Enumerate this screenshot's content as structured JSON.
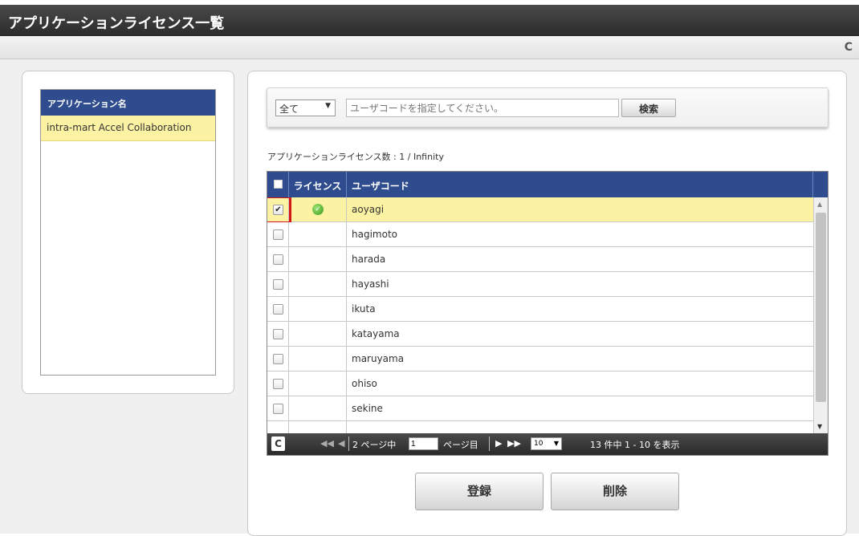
{
  "window": {
    "title": "アプリケーションライセンス一覧"
  },
  "toolbar": {
    "refresh_icon": "refresh-icon"
  },
  "app_list": {
    "header": "アプリケーション名",
    "items": [
      {
        "label": "intra-mart Accel Collaboration",
        "selected": true
      }
    ]
  },
  "search": {
    "filter_value": "全て",
    "input_placeholder": "ユーザコードを指定してください。",
    "input_value": "",
    "button_label": "検索"
  },
  "license_count": "アプリケーションライセンス数 : 1 / Infinity",
  "grid": {
    "columns": {
      "license": "ライセンス",
      "user_code": "ユーザコード"
    },
    "rows": [
      {
        "user_code": "aoyagi",
        "checked": true,
        "licensed": true,
        "selected": true
      },
      {
        "user_code": "hagimoto",
        "checked": false,
        "licensed": false
      },
      {
        "user_code": "harada",
        "checked": false,
        "licensed": false
      },
      {
        "user_code": "hayashi",
        "checked": false,
        "licensed": false
      },
      {
        "user_code": "ikuta",
        "checked": false,
        "licensed": false
      },
      {
        "user_code": "katayama",
        "checked": false,
        "licensed": false
      },
      {
        "user_code": "maruyama",
        "checked": false,
        "licensed": false
      },
      {
        "user_code": "ohiso",
        "checked": false,
        "licensed": false
      },
      {
        "user_code": "sekine",
        "checked": false,
        "licensed": false
      }
    ],
    "pager": {
      "total_pages_text": "2 ページ中",
      "page_value": "1",
      "page_suffix": "ページ目",
      "per_page": "10",
      "summary": "13 件中 1 - 10 を表示"
    }
  },
  "actions": {
    "register": "登録",
    "delete": "削除"
  },
  "colors": {
    "header_blue": "#2f4d8e",
    "selected_row": "#fcf2a3",
    "highlight_red": "#d41616",
    "titlebar_dark": "#333333"
  }
}
